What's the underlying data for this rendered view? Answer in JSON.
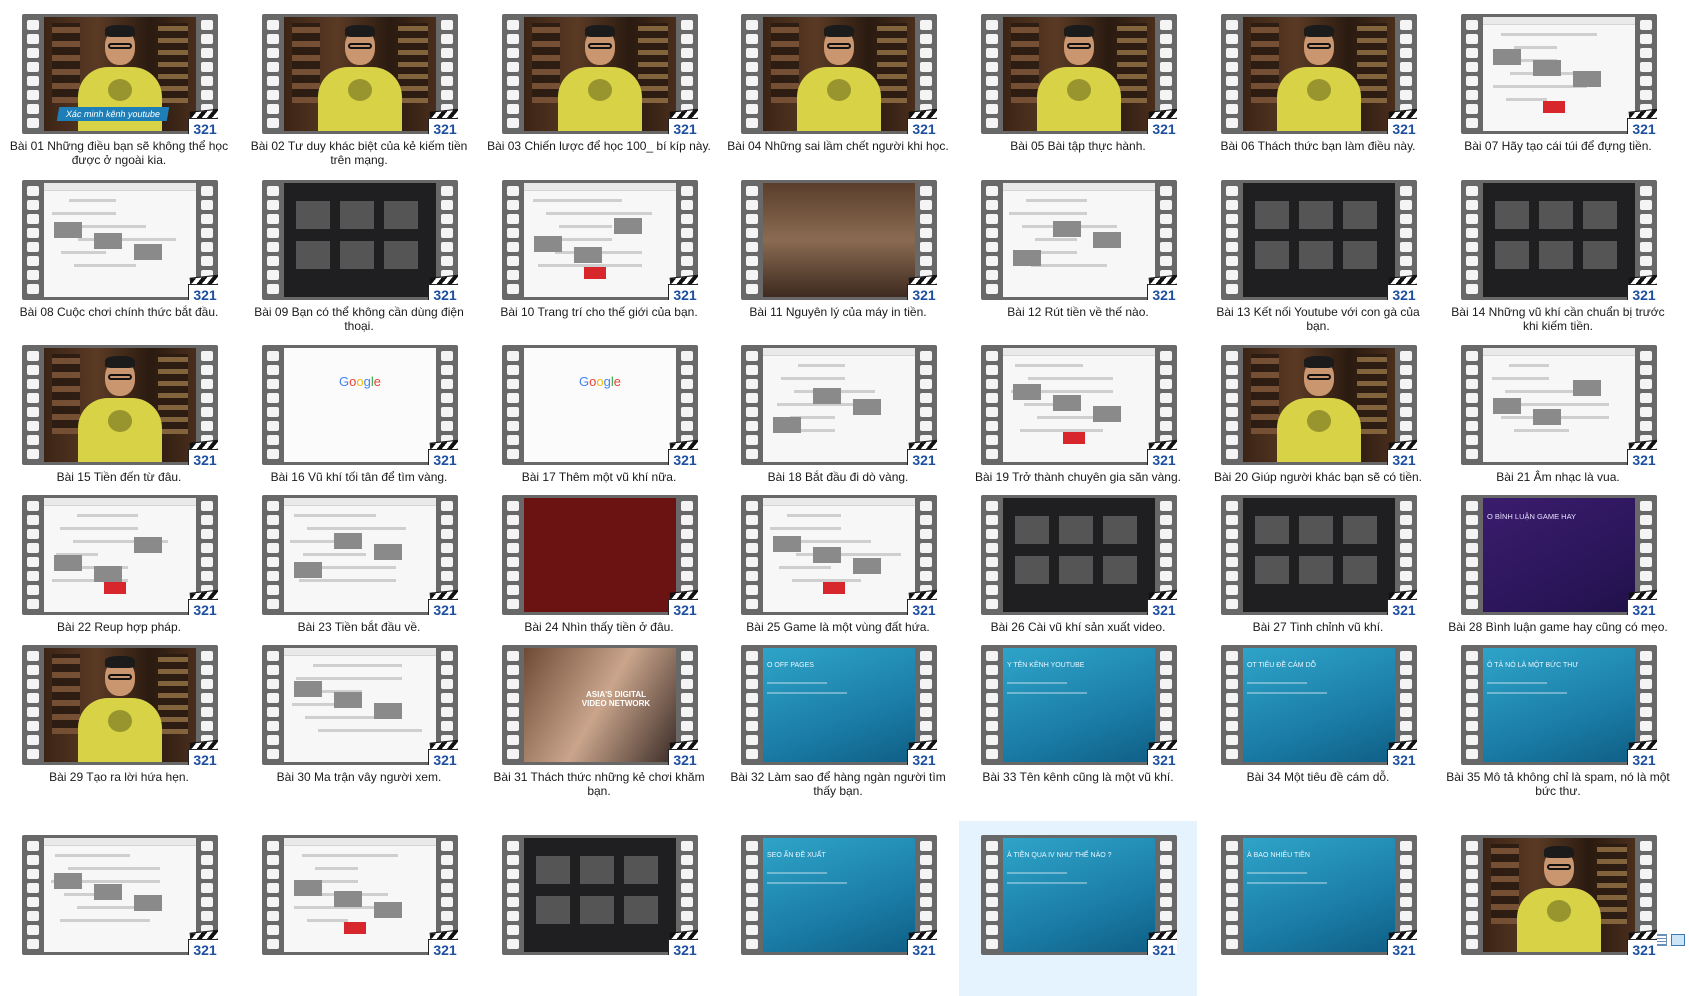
{
  "accent_color": "#1d4fa0",
  "selected_color": "#e5f3ff",
  "badge_text": "321",
  "videos": [
    {
      "label": "Bài 01 Những điều bạn sẽ không thể học được ở ngoài kia.",
      "thumb": "presenter",
      "overlay": "Xác minh kênh youtube"
    },
    {
      "label": "Bài 02 Tư duy khác biệt của kẻ kiếm tiền trên mạng.",
      "thumb": "presenter"
    },
    {
      "label": "Bài 03 Chiến lược để học 100_ bí kíp này.",
      "thumb": "presenter"
    },
    {
      "label": "Bài 04 Những sai lầm chết người khi học.",
      "thumb": "presenter"
    },
    {
      "label": "Bài 05 Bài tập thực hành.",
      "thumb": "presenter"
    },
    {
      "label": "Bài 06 Thách thức bạn làm điều này.",
      "thumb": "presenter"
    },
    {
      "label": "Bài 07 Hãy tạo cái túi để đựng tiền.",
      "thumb": "white"
    },
    {
      "label": "Bài 08 Cuộc chơi chính thức bắt đầu.",
      "thumb": "white"
    },
    {
      "label": "Bài 09 Bạn có thể không cần dùng điện thoại.",
      "thumb": "dark"
    },
    {
      "label": "Bài 10 Trang trí cho thế giới của bạn.",
      "thumb": "white"
    },
    {
      "label": "Bài 11 Nguyên lý của máy in tiền.",
      "thumb": "game"
    },
    {
      "label": "Bài 12 Rút tiền về thế nào.",
      "thumb": "white"
    },
    {
      "label": "Bài 13 Kết nối Youtube với con gà của bạn.",
      "thumb": "dark"
    },
    {
      "label": "Bài 14 Những vũ khí cần chuẩn bị trước khi kiếm tiền.",
      "thumb": "dark"
    },
    {
      "label": "Bài 15 Tiền đến từ đâu.",
      "thumb": "presenter"
    },
    {
      "label": "Bài 16 Vũ khí tối tân để tìm vàng.",
      "thumb": "google",
      "overlay": "Google"
    },
    {
      "label": "Bài 17 Thêm một vũ khí nữa.",
      "thumb": "google",
      "overlay": "Google"
    },
    {
      "label": "Bài 18 Bắt đầu đi dò vàng.",
      "thumb": "white"
    },
    {
      "label": "Bài 19 Trở thành chuyên gia săn vàng.",
      "thumb": "white"
    },
    {
      "label": "Bài 20 Giúp người khác bạn sẽ có tiền.",
      "thumb": "presenter"
    },
    {
      "label": "Bài 21 Âm nhạc là vua.",
      "thumb": "white"
    },
    {
      "label": "Bài 22 Reup hợp pháp.",
      "thumb": "white"
    },
    {
      "label": "Bài 23 Tiền bắt đầu về.",
      "thumb": "white"
    },
    {
      "label": "Bài 24 Nhìn thấy tiền ở đâu.",
      "thumb": "red"
    },
    {
      "label": "Bài 25 Game là một vùng đất hứa.",
      "thumb": "white"
    },
    {
      "label": "Bài 26 Cài vũ khí sản xuất video.",
      "thumb": "dark"
    },
    {
      "label": "Bài 27 Tinh chỉnh vũ khí.",
      "thumb": "dark"
    },
    {
      "label": "Bài 28 Bình luận game hay cũng có mẹo.",
      "thumb": "purple",
      "overlay": "O BÌNH LUẬN GAME HAY"
    },
    {
      "label": "Bài 29 Tạo ra lời hứa hẹn.",
      "thumb": "presenter"
    },
    {
      "label": "Bài 30 Ma trận vây người xem.",
      "thumb": "white"
    },
    {
      "label": "Bài 31 Thách thức những kẻ chơi khăm bạn.",
      "thumb": "ads",
      "overlay": "ASIA'S DIGITAL VIDEO NETWORK"
    },
    {
      "label": "Bài 32 Làm sao để hàng ngàn người tìm thấy bạn.",
      "thumb": "blue",
      "overlay": "O OFF PAGES"
    },
    {
      "label": "Bài 33 Tên kênh cũng là một vũ khí.",
      "thumb": "blue",
      "overlay": "Y TÊN KÊNH YOUTUBE"
    },
    {
      "label": "Bài 34 Một tiêu đề cám dỗ.",
      "thumb": "blue",
      "overlay": "OT TIÊU ĐỀ CÁM DỖ"
    },
    {
      "label": "Bài 35 Mô tả không chỉ là spam, nó là một bức thư.",
      "thumb": "blue",
      "overlay": "Ô TẢ NÓ LÀ MỘT BỨC THƯ"
    },
    {
      "label": "",
      "thumb": "white"
    },
    {
      "label": "",
      "thumb": "white"
    },
    {
      "label": "",
      "thumb": "dark"
    },
    {
      "label": "",
      "thumb": "blue",
      "overlay": "SEO ẨN ĐỀ XUẤT"
    },
    {
      "label": "",
      "thumb": "blue",
      "overlay": "À TIỀN QUA IV NHƯ THẾ NÀO ?",
      "selected": true
    },
    {
      "label": "",
      "thumb": "blue",
      "overlay": "À BAO NHIÊU TIỀN"
    },
    {
      "label": "",
      "thumb": "presenter"
    }
  ],
  "status_icons": [
    "details-view-icon",
    "large-icons-view-icon"
  ]
}
